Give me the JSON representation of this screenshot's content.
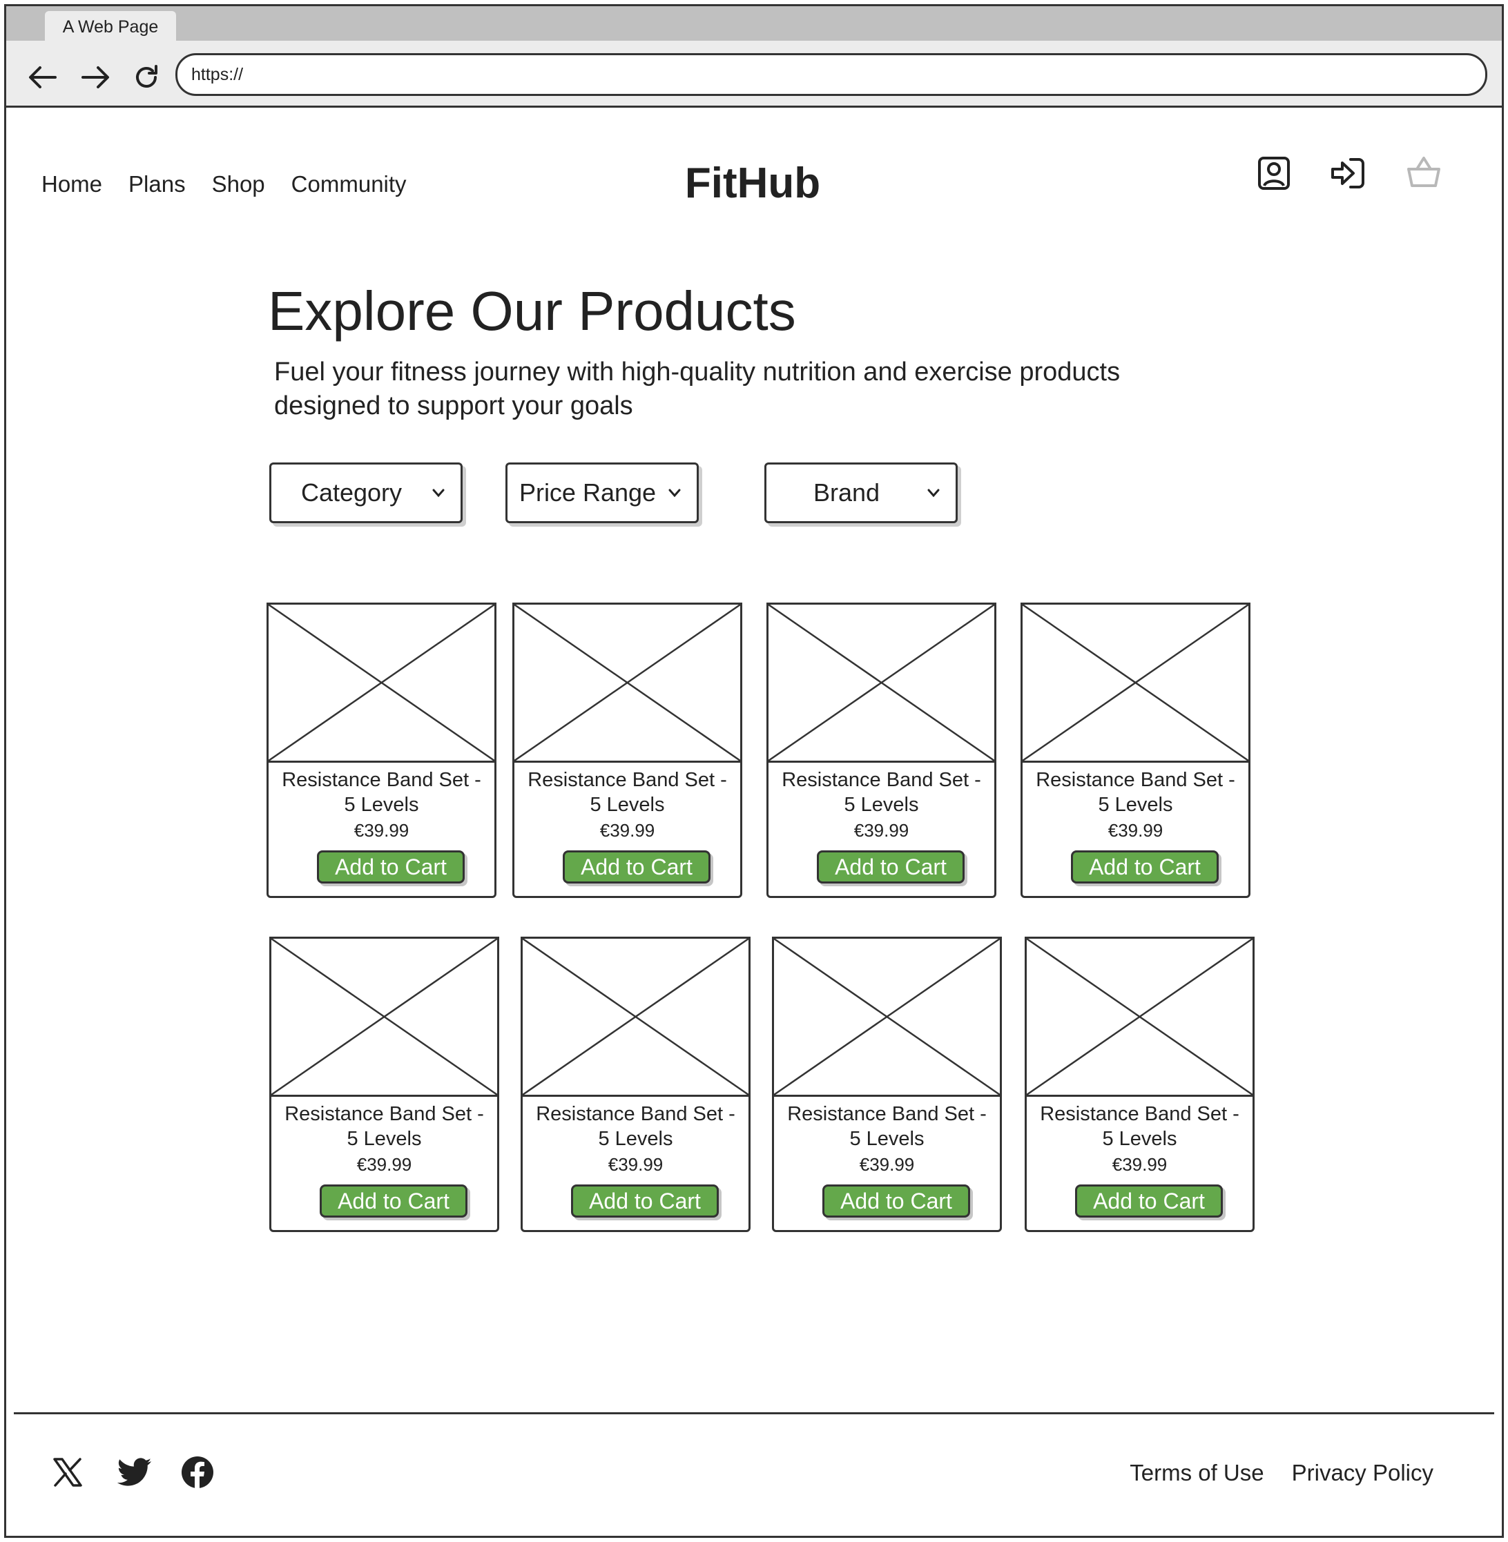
{
  "browser": {
    "tab_title": "A Web Page",
    "url": "https://"
  },
  "nav": {
    "items": [
      "Home",
      "Plans",
      "Shop",
      "Community"
    ],
    "brand": "FitHub"
  },
  "hero": {
    "title": "Explore Our Products",
    "subtitle_line1": "Fuel your fitness journey with high-quality nutrition and exercise products",
    "subtitle_line2": "designed to support your goals"
  },
  "filters": [
    "Category",
    "Price Range",
    "Brand"
  ],
  "products": [
    {
      "name_line1": "Resistance Band Set -",
      "name_line2": "5 Levels",
      "price": "€39.99",
      "button": "Add to Cart"
    },
    {
      "name_line1": "Resistance Band Set -",
      "name_line2": "5 Levels",
      "price": "€39.99",
      "button": "Add to Cart"
    },
    {
      "name_line1": "Resistance Band Set -",
      "name_line2": "5 Levels",
      "price": "€39.99",
      "button": "Add to Cart"
    },
    {
      "name_line1": "Resistance Band Set -",
      "name_line2": "5 Levels",
      "price": "€39.99",
      "button": "Add to Cart"
    },
    {
      "name_line1": "Resistance Band Set -",
      "name_line2": "5 Levels",
      "price": "€39.99",
      "button": "Add to Cart"
    },
    {
      "name_line1": "Resistance Band Set -",
      "name_line2": "5 Levels",
      "price": "€39.99",
      "button": "Add to Cart"
    },
    {
      "name_line1": "Resistance Band Set -",
      "name_line2": "5 Levels",
      "price": "€39.99",
      "button": "Add to Cart"
    },
    {
      "name_line1": "Resistance Band Set -",
      "name_line2": "5 Levels",
      "price": "€39.99",
      "button": "Add to Cart"
    }
  ],
  "footer": {
    "links": [
      "Terms of Use",
      "Privacy Policy"
    ],
    "social_icons": [
      "x-icon",
      "twitter-icon",
      "facebook-icon"
    ]
  },
  "colors": {
    "button_green": "#64a84b",
    "cart_icon_muted": "#b8b8b8"
  }
}
